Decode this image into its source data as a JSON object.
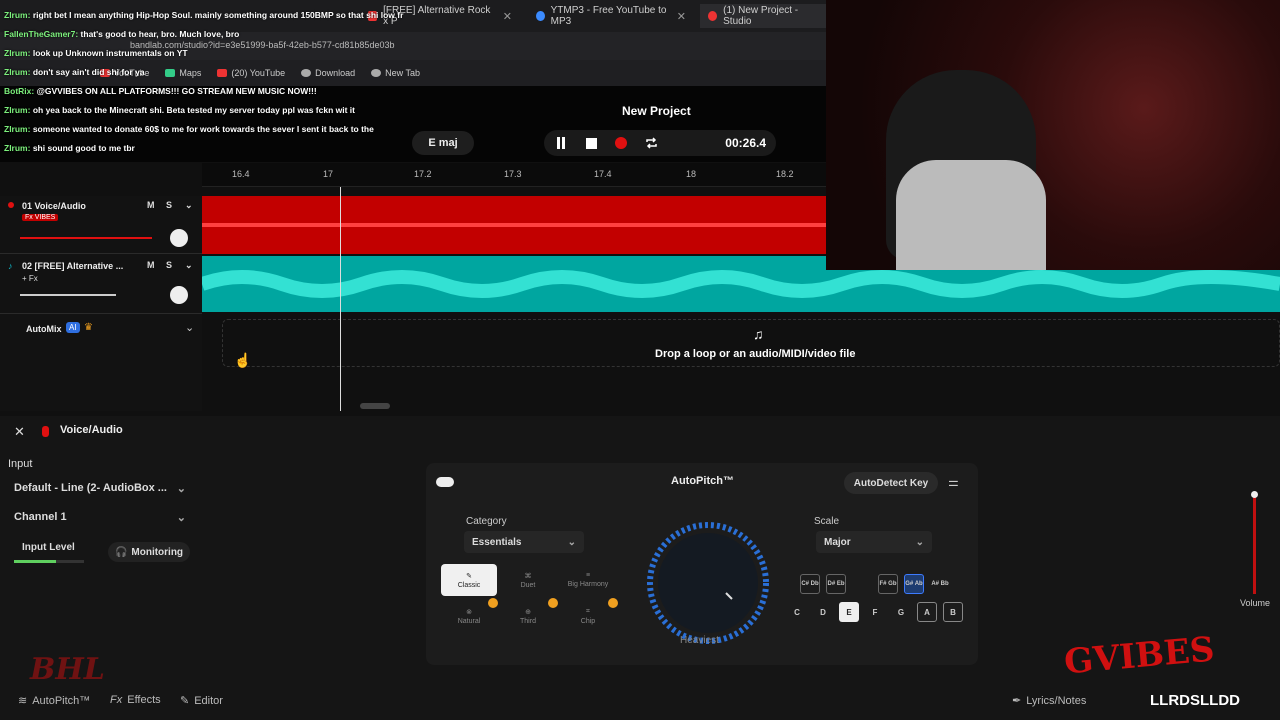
{
  "browser": {
    "tabs": [
      {
        "title": "[FREE] Alternative Rock x P"
      },
      {
        "title": "YTMP3 - Free YouTube to MP3"
      },
      {
        "title": "(1) New Project - Studio"
      }
    ],
    "url": "bandlab.com/studio?id=e3e51999-ba5f-42eb-b577-cd81b85de03b",
    "bookmarks": [
      "YouTube",
      "Maps",
      "(20) YouTube",
      "Download",
      "New Tab"
    ]
  },
  "app": {
    "project_title": "New Project",
    "key": "E maj",
    "time": "00:26.4",
    "ruler_ticks": [
      "16.4",
      "17",
      "17.2",
      "17.3",
      "17.4",
      "18",
      "18.2"
    ],
    "tracks": [
      {
        "name": "01  Voice/Audio",
        "badge": "Fx VIBES",
        "color": "#c20000"
      },
      {
        "name": "02  [FREE] Alternative ...",
        "badge": "+ Fx",
        "color": "#00a6a0"
      }
    ],
    "automix": {
      "label": "AutoMix",
      "ai": "AI"
    },
    "drop_text": "Drop a loop or an audio/MIDI/video file"
  },
  "panel": {
    "title": "Voice/Audio",
    "input_label": "Input",
    "input_device": "Default - Line (2- AudioBox ...",
    "channel": "Channel 1",
    "input_level": "Input Level",
    "monitoring": "Monitoring",
    "autopitch": {
      "title": "AutoPitch™",
      "detect": "AutoDetect Key",
      "category_label": "Category",
      "category_value": "Essentials",
      "presets": [
        "Classic",
        "Duet",
        "Big Harmony",
        "Natural",
        "Third",
        "Chip"
      ],
      "knob_label": "Heaviest",
      "scale_label": "Scale",
      "scale_value": "Major",
      "sharps": [
        "C# Db",
        "D# Eb",
        "F# Gb",
        "G# Ab",
        "A# Bb"
      ],
      "naturals": [
        "C",
        "D",
        "E",
        "F",
        "G",
        "A",
        "B"
      ]
    },
    "volume_label": "Volume",
    "footer": [
      "AutoPitch™",
      "Effects",
      "Editor",
      "Lyrics/Notes"
    ]
  },
  "chat": [
    {
      "user": "ZIrum:",
      "msg": "right bet I mean anything Hip-Hop Soul. mainly something around 150BMP so that shi low fr"
    },
    {
      "user": "FallenTheGamer7:",
      "msg": "that's good to hear, bro. Much love, bro"
    },
    {
      "user": "ZIrum:",
      "msg": "look up Unknown instrumentals on YT"
    },
    {
      "user": "ZIrum:",
      "msg": "don't say ain't did shi for ya"
    },
    {
      "user": "BotRix:",
      "msg": "@GVVIBES ON ALL PLATFORMS!!! GO STREAM NEW MUSIC NOW!!!"
    },
    {
      "user": "ZIrum:",
      "msg": "oh yea back to the Minecraft shi. Beta tested my server today ppl was fckn wit it"
    },
    {
      "user": "ZIrum:",
      "msg": "someone wanted to donate 60$ to me for work towards the sever I sent it back to the"
    },
    {
      "user": "ZIrum:",
      "msg": "shi sound good to me tbr"
    }
  ],
  "overlay": {
    "logo_left": "BHL",
    "logo_right": "GVIBES",
    "ticker": "LLRDSLLDD"
  },
  "colors": {
    "red": "#c20000",
    "teal": "#00a6a0",
    "accent": "#3d7bff",
    "orange": "#f0a020"
  }
}
